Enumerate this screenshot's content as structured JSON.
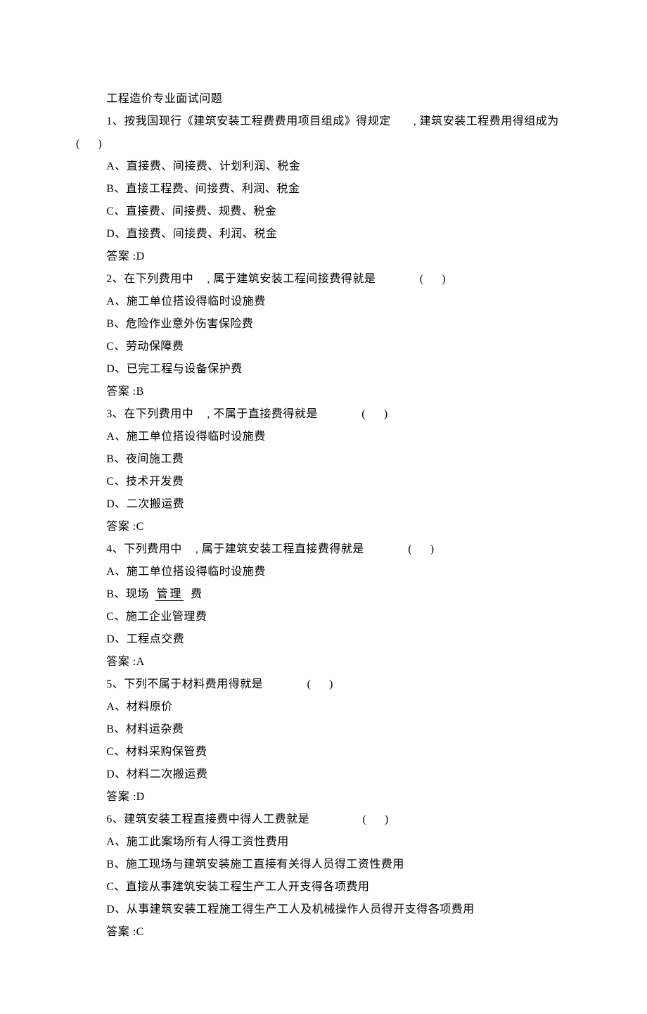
{
  "title": "工程造价专业面试问题",
  "questions": [
    {
      "num": "1",
      "stem_a": "、按我国现行《建筑安装工程费费用项目组成》得规定",
      "stem_b": ", 建筑安装工程费用得组成为",
      "options": [
        "A、直接费、间接费、计划利润、税金",
        "B、直接工程费、间接费、利润、税金",
        "C、直接费、间接费、规费、税金",
        "D、直接费、间接费、利润、税金"
      ],
      "answer_label": "答案 :",
      "answer": "D",
      "left_paren": true
    },
    {
      "num": "2",
      "stem_a": "、在下列费用中",
      "stem_b": ", 属于建筑安装工程间接费得就是",
      "options": [
        "A、施工单位搭设得临时设施费",
        "B、危险作业意外伤害保险费",
        "C、劳动保障费",
        "D、已完工程与设备保护费"
      ],
      "answer_label": "答案 :",
      "answer": "B"
    },
    {
      "num": "3",
      "stem_a": "、在下列费用中",
      "stem_b": ", 不属于直接费得就是",
      "options": [
        "A、施工单位搭设得临时设施费",
        "B、夜间施工费",
        "C、技术开发费",
        "D、二次搬运费"
      ],
      "answer_label": "答案 :",
      "answer": "C"
    },
    {
      "num": "4",
      "stem_a": "、下列费用中",
      "stem_b": ", 属于建筑安装工程直接费得就是",
      "options_special": {
        "A": "A、施工单位搭设得临时设施费",
        "B_prefix": "B、现场",
        "B_mid": "管理",
        "B_suffix": "费",
        "C": "C、施工企业管理费",
        "D": "D、工程点交费"
      },
      "answer_label": "答案 :",
      "answer": "A"
    },
    {
      "num": "5",
      "stem_a": "、下列不属于材料费用得就是",
      "stem_b": "",
      "options": [
        "A、材料原价",
        "B、材料运杂费",
        "C、材料采购保管费",
        "D、材料二次搬运费"
      ],
      "answer_label": "答案 :",
      "answer": "D"
    },
    {
      "num": "6",
      "stem_a": "、建筑安装工程直接费中得人工费就是",
      "stem_b": "",
      "options": [
        "A、施工此案场所有人得工资性费用",
        "B、施工现场与建筑安装施工直接有关得人员得工资性费用",
        "C、直接从事建筑安装工程生产工人开支得各项费用",
        "D、从事建筑安装工程施工得生产工人及机械操作人员得开支得各项费用"
      ],
      "answer_label": "答案 :",
      "answer": "C"
    }
  ]
}
